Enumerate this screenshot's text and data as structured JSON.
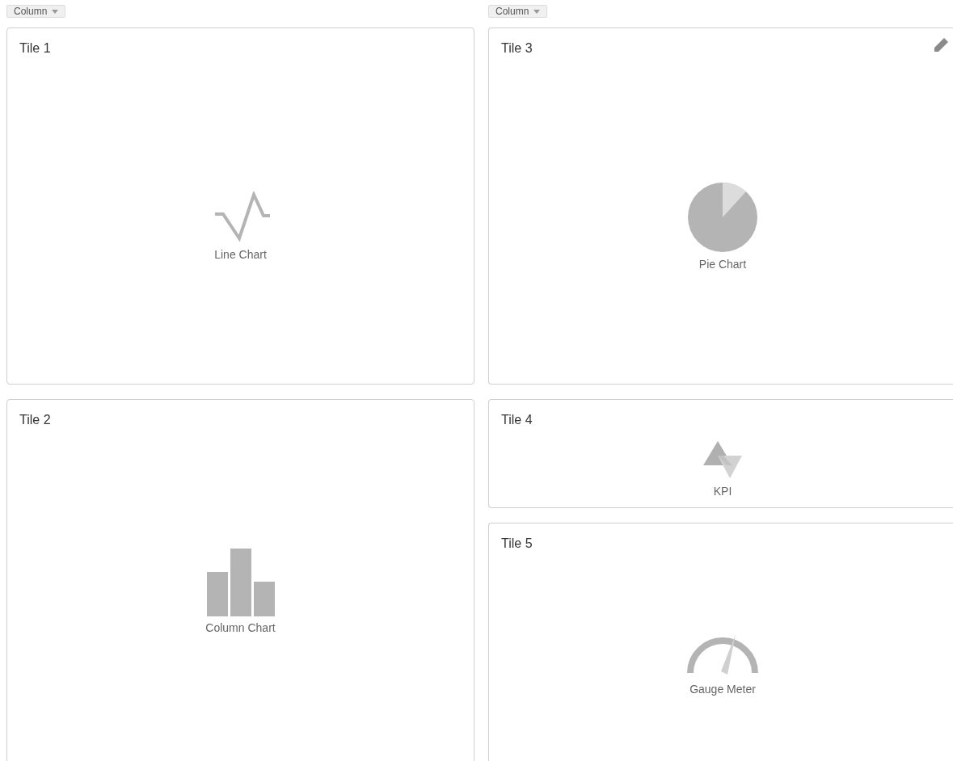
{
  "columns": [
    {
      "menu": "Column",
      "tiles": [
        {
          "title": "Tile 1",
          "kind": "line",
          "label": "Line Chart",
          "edit_icon": false
        },
        {
          "title": "Tile 2",
          "kind": "column",
          "label": "Column Chart",
          "edit_icon": false
        }
      ]
    },
    {
      "menu": "Column",
      "tiles": [
        {
          "title": "Tile 3",
          "kind": "pie",
          "label": "Pie Chart",
          "edit_icon": true
        },
        {
          "title": "Tile 4",
          "kind": "kpi",
          "label": "KPI",
          "edit_icon": false
        },
        {
          "title": "Tile 5",
          "kind": "gauge",
          "label": "Gauge Meter",
          "edit_icon": false
        }
      ]
    }
  ]
}
